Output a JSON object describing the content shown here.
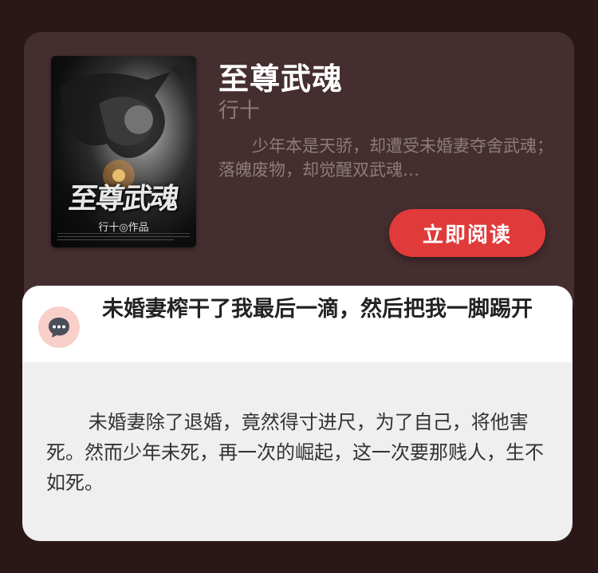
{
  "book": {
    "cover_title": "至尊武魂",
    "cover_author": "行十◎作品",
    "title": "至尊武魂",
    "author": "行十",
    "summary": "少年本是天骄，却遭受未婚妻夺舍武魂；落魄废物，却觉醒双武魂…",
    "read_button": "立即阅读"
  },
  "comment": {
    "icon": "chat-bubble-icon",
    "title": "未婚妻榨干了我最后一滴，然后把我一脚踢开",
    "body": "未婚妻除了退婚，竟然得寸进尺，为了自己，将他害死。然而少年未死，再一次的崛起，这一次要那贱人，生不如死。"
  },
  "colors": {
    "background": "#2a1819",
    "book_card": "#452e30",
    "accent": "#e03b3a",
    "icon_bg": "#f9cfc9",
    "icon_fg": "#4a4d5a"
  }
}
